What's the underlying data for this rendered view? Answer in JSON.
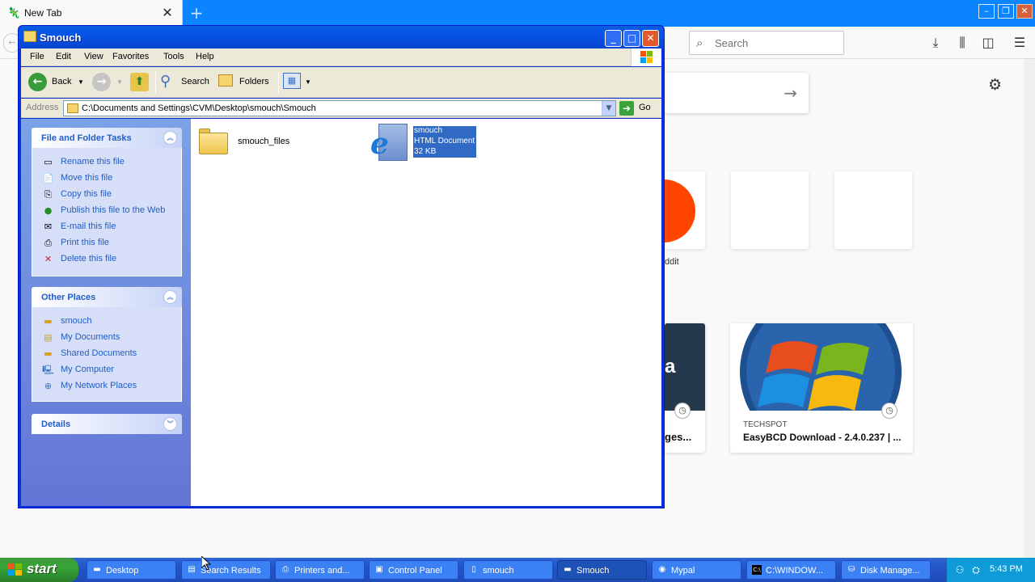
{
  "firefox": {
    "tab_title": "New Tab",
    "search_placeholder": "Search",
    "top_sites": [
      {
        "label": "ddit"
      }
    ],
    "highlights": [
      {
        "title": "ges...",
        "image_letter": "a"
      },
      {
        "source": "TECHSPOT",
        "title": "EasyBCD Download - 2.4.0.237 | ..."
      }
    ]
  },
  "explorer": {
    "title": "Smouch",
    "menu": [
      "File",
      "Edit",
      "View",
      "Favorites",
      "Tools",
      "Help"
    ],
    "toolbar": {
      "back": "Back",
      "search": "Search",
      "folders": "Folders"
    },
    "address": {
      "label": "Address",
      "path": "C:\\Documents and Settings\\CVM\\Desktop\\smouch\\Smouch",
      "go": "Go"
    },
    "task_panels": [
      {
        "title": "File and Folder Tasks",
        "items": [
          {
            "label": "Rename this file",
            "icon": "rename-icon"
          },
          {
            "label": "Move this file",
            "icon": "move-icon"
          },
          {
            "label": "Copy this file",
            "icon": "copy-icon"
          },
          {
            "label": "Publish this file to the Web",
            "icon": "globe-icon"
          },
          {
            "label": "E-mail this file",
            "icon": "email-icon"
          },
          {
            "label": "Print this file",
            "icon": "printer-icon"
          },
          {
            "label": "Delete this file",
            "icon": "delete-icon"
          }
        ]
      },
      {
        "title": "Other Places",
        "items": [
          {
            "label": "smouch",
            "icon": "folder-icon"
          },
          {
            "label": "My Documents",
            "icon": "documents-icon"
          },
          {
            "label": "Shared Documents",
            "icon": "folder-icon"
          },
          {
            "label": "My Computer",
            "icon": "computer-icon"
          },
          {
            "label": "My Network Places",
            "icon": "network-icon"
          }
        ]
      },
      {
        "title": "Details",
        "items": []
      }
    ],
    "files": [
      {
        "name": "smouch_files",
        "type": "folder"
      },
      {
        "name": "smouch",
        "kind": "HTML Document",
        "size": "32 KB",
        "selected": true
      }
    ]
  },
  "taskbar": {
    "start": "start",
    "tasks": [
      {
        "label": "Desktop",
        "icon": "folder-icon"
      },
      {
        "label": "Search Results",
        "icon": "search-results-icon"
      },
      {
        "label": "Printers and...",
        "icon": "printer-icon"
      },
      {
        "label": "Control Panel",
        "icon": "control-panel-icon"
      },
      {
        "label": "smouch",
        "icon": "document-icon"
      },
      {
        "label": "Smouch",
        "icon": "folder-icon",
        "active": true
      },
      {
        "label": "Mypal",
        "icon": "browser-icon"
      },
      {
        "label": "C:\\WINDOW...",
        "icon": "console-icon"
      },
      {
        "label": "Disk Manage...",
        "icon": "disk-icon"
      }
    ],
    "clock": "5:43 PM"
  },
  "colors": {
    "firefox_tabbar": "#0a84ff",
    "xp_titlebar": "#0654e8",
    "xp_taskpane": "#6375d6",
    "selection": "#316ac5",
    "start_green": "#36a436",
    "taskbar_blue": "#2456c8"
  }
}
